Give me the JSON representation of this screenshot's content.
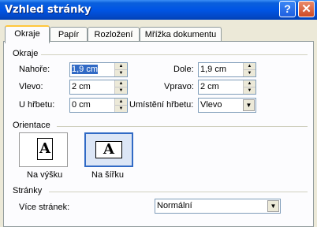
{
  "window": {
    "title": "Vzhled stránky",
    "help_glyph": "?",
    "close_glyph": "✕"
  },
  "tabs": [
    {
      "label": "Okraje"
    },
    {
      "label": "Papír"
    },
    {
      "label": "Rozložení"
    },
    {
      "label": "Mřížka dokumentu"
    }
  ],
  "margins": {
    "group_label": "Okraje",
    "top": {
      "label": "Nahoře:",
      "value": "1,9 cm"
    },
    "bottom": {
      "label": "Dole:",
      "value": "1,9 cm"
    },
    "left": {
      "label": "Vlevo:",
      "value": "2 cm"
    },
    "right": {
      "label": "Vpravo:",
      "value": "2 cm"
    },
    "gutter": {
      "label": "U hřbetu:",
      "value": "0 cm"
    },
    "gutter_position": {
      "label": "Umístění hřbetu:",
      "value": "Vlevo"
    }
  },
  "orientation": {
    "group_label": "Orientace",
    "portrait": {
      "label": "Na výšku",
      "icon_letter": "A"
    },
    "landscape": {
      "label": "Na šířku",
      "icon_letter": "A",
      "selected": true
    }
  },
  "pages": {
    "group_label": "Stránky",
    "multiple": {
      "label": "Více stránek:",
      "value": "Normální"
    }
  },
  "icons": {
    "spin_up": "▲",
    "spin_down": "▼",
    "dropdown": "▼"
  }
}
